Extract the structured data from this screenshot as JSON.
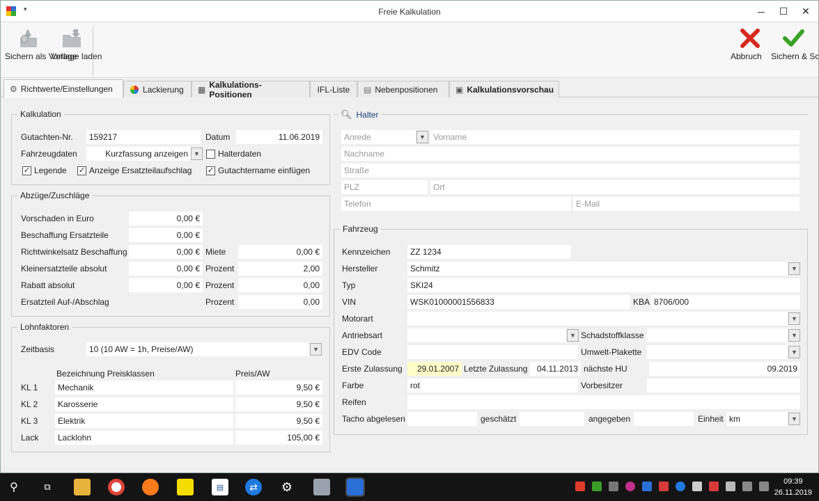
{
  "window": {
    "title": "Freie Kalkulation"
  },
  "ribbon": {
    "save_template": "Sichern als Vorlage",
    "load_template": "Vorlage laden",
    "cancel": "Abbruch",
    "save_close": "Sichern & Schließen"
  },
  "tabs": [
    {
      "label": "Richtwerte/Einstellungen"
    },
    {
      "label": "Lackierung"
    },
    {
      "label": "Kalkulations-Positionen"
    },
    {
      "label": "IFL-Liste"
    },
    {
      "label": "Nebenpositionen"
    },
    {
      "label": "Kalkulationsvorschau"
    }
  ],
  "kalkulation": {
    "title": "Kalkulation",
    "gutachten_label": "Gutachten-Nr.",
    "gutachten_value": "159217",
    "datum_label": "Datum",
    "datum_value": "11.06.2019",
    "fahrzeugdaten_label": "Fahrzeugdaten",
    "fahrzeugdaten_value": "Kurzfassung anzeigen",
    "halterdaten_label": "Halterdaten",
    "legende_label": "Legende",
    "ersatzteil_label": "Anzeige Ersatzteilaufschlag",
    "gutachtername_label": "Gutachtername einfügen"
  },
  "abzuege": {
    "title": "Abzüge/Zuschläge",
    "vorschaden_label": "Vorschaden in Euro",
    "vorschaden_value": "0,00 €",
    "beschaffung_label": "Beschaffung Ersatzteile",
    "beschaffung_value": "0,00 €",
    "richtwinkel_label": "Richtwinkelsatz Beschaffung",
    "richtwinkel_value": "0,00 €",
    "miete_label": "Miete",
    "miete_value": "0,00 €",
    "kleinersatz_label": "Kleinersatzteile absolut",
    "kleinersatz_value": "0,00 €",
    "prozent1_label": "Prozent",
    "prozent1_value": "2,00",
    "rabatt_label": "Rabatt absolut",
    "rabatt_value": "0,00 €",
    "prozent2_label": "Prozent",
    "prozent2_value": "0,00",
    "aufabschlag_label": "Ersatzteil Auf-/Abschlag",
    "prozent3_label": "Prozent",
    "prozent3_value": "0,00"
  },
  "lohnfaktoren": {
    "title": "Lohnfaktoren",
    "zeitbasis_label": "Zeitbasis",
    "zeitbasis_value": "10 (10 AW = 1h, Preise/AW)",
    "col_bezeichnung": "Bezeichnung Preisklassen",
    "col_preis": "Preis/AW",
    "rows": [
      {
        "kl": "KL 1",
        "name": "Mechanik",
        "preis": "9,50 €"
      },
      {
        "kl": "KL 2",
        "name": "Karosserie",
        "preis": "9,50 €"
      },
      {
        "kl": "KL 3",
        "name": "Elektrik",
        "preis": "9,50 €"
      },
      {
        "kl": "Lack",
        "name": "Lacklohn",
        "preis": "105,00 €"
      }
    ]
  },
  "halter": {
    "title": "Halter",
    "anrede_placeholder": "Anrede",
    "vorname_placeholder": "Vorname",
    "nachname_placeholder": "Nachname",
    "strasse_placeholder": "Straße",
    "plz_placeholder": "PLZ",
    "ort_placeholder": "Ort",
    "telefon_placeholder": "Telefon",
    "email_placeholder": "E-Mail"
  },
  "fahrzeug": {
    "title": "Fahrzeug",
    "kennzeichen_label": "Kennzeichen",
    "kennzeichen_value": "ZZ 1234",
    "hersteller_label": "Hersteller",
    "hersteller_value": "Schmitz",
    "typ_label": "Typ",
    "typ_value": "SKI24",
    "vin_label": "VIN",
    "vin_value": "WSK01000001556833",
    "kba_label": "KBA",
    "kba_value": "8706/000",
    "motorart_label": "Motorart",
    "antriebsart_label": "Antriebsart",
    "schadstoff_label": "Schadstoffklasse",
    "edv_label": "EDV Code",
    "umwelt_label": "Umwelt-Plakette",
    "erstzulassung_label": "Erste Zulassung",
    "erstzulassung_value": "29.01.2007",
    "letztezulassung_label": "Letzte Zulassung",
    "letztezulassung_value": "04.11.2013",
    "naechstehu_label": "nächste HU",
    "naechstehu_value": "09.2019",
    "farbe_label": "Farbe",
    "farbe_value": "rot",
    "vorbesitzer_label": "Vorbesitzer",
    "reifen_label": "Reifen",
    "tacho_label": "Tacho abgelesen",
    "geschaetzt_label": "geschätzt",
    "angegeben_label": "angegeben",
    "einheit_label": "Einheit",
    "einheit_value": "km"
  },
  "taskbar": {
    "time": "09:39",
    "date": "26.11.2019"
  }
}
